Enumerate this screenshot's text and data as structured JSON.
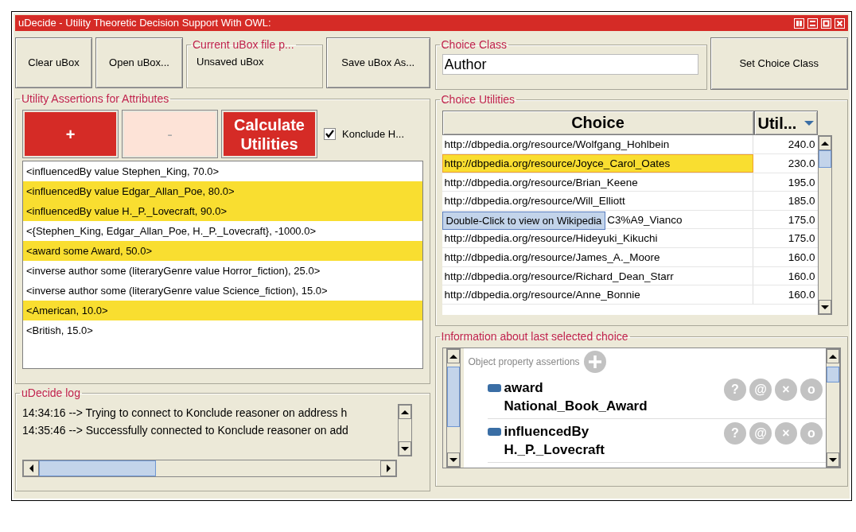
{
  "window": {
    "title": "uDecide - Utility Theoretic Decision Support With OWL:"
  },
  "toolbar": {
    "buttons": [
      "Clear uBox",
      "Open uBox..."
    ],
    "file_path": {
      "legend": "Current uBox file p...",
      "value": "Unsaved uBox"
    },
    "save_button": "Save uBox As..."
  },
  "assertions": {
    "legend": "Utility Assertions for Attributes",
    "add_button": {
      "label": "+",
      "disabled": false
    },
    "remove_button": {
      "label": "-",
      "disabled": true
    },
    "calculate_button": "Calculate Utilities",
    "checkbox": {
      "label": "Konclude H...",
      "checked": true
    },
    "items": [
      {
        "text": "<influencedBy value Stephen_King, 70.0>",
        "selected": false
      },
      {
        "text": "<influencedBy value Edgar_Allan_Poe, 80.0>",
        "selected": true
      },
      {
        "text": "<influencedBy value H._P._Lovecraft, 90.0>",
        "selected": true
      },
      {
        "text": "<{Stephen_King, Edgar_Allan_Poe, H._P._Lovecraft}, -1000.0>",
        "selected": false
      },
      {
        "text": "<award some Award, 50.0>",
        "selected": true
      },
      {
        "text": "<inverse author some (literaryGenre value Horror_fiction), 25.0>",
        "selected": false
      },
      {
        "text": "<inverse author some (literaryGenre value Science_fiction), 15.0>",
        "selected": false
      },
      {
        "text": "<American, 10.0>",
        "selected": true
      },
      {
        "text": "<British, 15.0>",
        "selected": false
      }
    ]
  },
  "log": {
    "legend": "uDecide log",
    "lines": [
      "14:34:16 --> Trying to connect to Konclude reasoner on address h",
      "14:35:46 --> Successfully connected to Konclude reasoner on add"
    ]
  },
  "choice_class": {
    "legend": "Choice Class",
    "value": "Author",
    "button": "Set Choice Class"
  },
  "choice_utilities": {
    "legend": "Choice Utilities",
    "columns": [
      "Choice",
      "Util..."
    ],
    "tooltip": "Double-Click to view on Wikipedia",
    "rows": [
      {
        "choice": "http://dbpedia.org/resource/Wolfgang_Hohlbein",
        "utility": "240.0",
        "selected": false
      },
      {
        "choice": "http://dbpedia.org/resource/Joyce_Carol_Oates",
        "utility": "230.0",
        "selected": true
      },
      {
        "choice": "http://dbpedia.org/resource/Brian_Keene",
        "utility": "195.0",
        "selected": false
      },
      {
        "choice": "http://dbpedia.org/resource/Will_Elliott",
        "utility": "185.0",
        "selected": false
      },
      {
        "choice": "C3%A9_Vianco",
        "utility": "175.0",
        "selected": false,
        "tooltip_over": true
      },
      {
        "choice": "http://dbpedia.org/resource/Hideyuki_Kikuchi",
        "utility": "175.0",
        "selected": false
      },
      {
        "choice": "http://dbpedia.org/resource/James_A._Moore",
        "utility": "160.0",
        "selected": false
      },
      {
        "choice": "http://dbpedia.org/resource/Richard_Dean_Starr",
        "utility": "160.0",
        "selected": false
      },
      {
        "choice": "http://dbpedia.org/resource/Anne_Bonnie",
        "utility": "160.0",
        "selected": false
      }
    ]
  },
  "information": {
    "legend": "Information about last selected choice",
    "section_title": "Object property assertions",
    "assertions": [
      {
        "property": "award",
        "value": "National_Book_Award",
        "actions": [
          "?",
          "@",
          "×",
          "o"
        ]
      },
      {
        "property": "influencedBy",
        "value": "H._P._Lovecraft",
        "actions": [
          "?",
          "@",
          "×",
          "o"
        ]
      }
    ]
  }
}
